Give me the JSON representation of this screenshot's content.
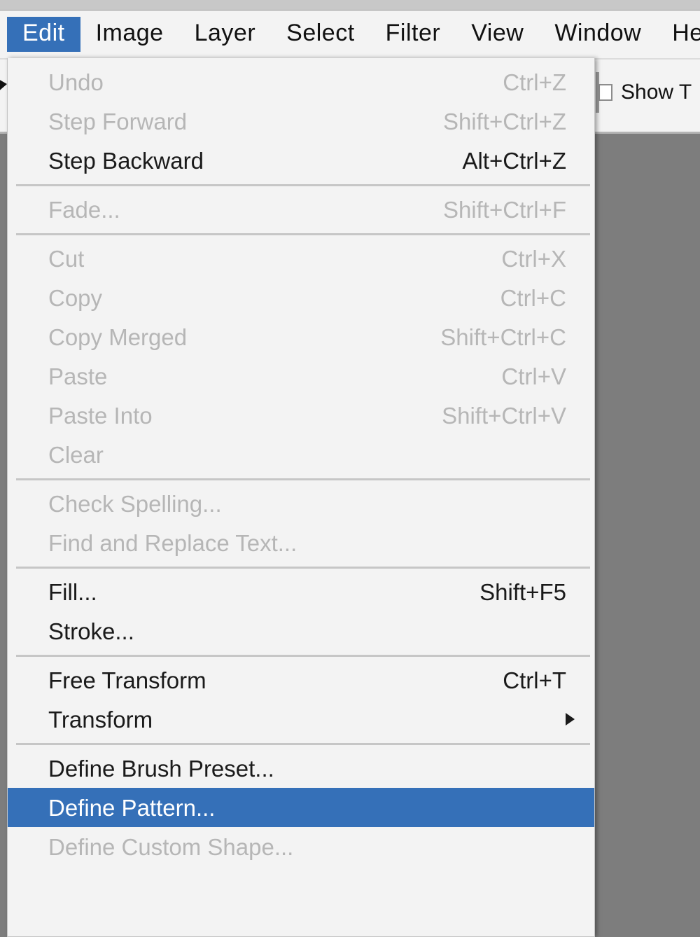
{
  "app": {
    "background_color": "#808080",
    "canvas_color": "#7d7d7d",
    "accent_color": "#3570b8",
    "panel_color": "#f3f3f3",
    "disabled_text_color": "#b6b6b6"
  },
  "menubar": {
    "items": [
      {
        "label": "Edit",
        "active": true
      },
      {
        "label": "Image",
        "active": false
      },
      {
        "label": "Layer",
        "active": false
      },
      {
        "label": "Select",
        "active": false
      },
      {
        "label": "Filter",
        "active": false
      },
      {
        "label": "View",
        "active": false
      },
      {
        "label": "Window",
        "active": false
      },
      {
        "label": "Help",
        "active": false
      }
    ]
  },
  "options_bar": {
    "checkbox_checked": false,
    "show_label": "Show T"
  },
  "dropdown": {
    "title": "Edit",
    "rows": [
      {
        "type": "item",
        "label": "Undo",
        "shortcut": "Ctrl+Z",
        "state": "disabled"
      },
      {
        "type": "item",
        "label": "Step Forward",
        "shortcut": "Shift+Ctrl+Z",
        "state": "disabled"
      },
      {
        "type": "item",
        "label": "Step Backward",
        "shortcut": "Alt+Ctrl+Z",
        "state": "enabled"
      },
      {
        "type": "separator"
      },
      {
        "type": "item",
        "label": "Fade...",
        "shortcut": "Shift+Ctrl+F",
        "state": "disabled"
      },
      {
        "type": "separator"
      },
      {
        "type": "item",
        "label": "Cut",
        "shortcut": "Ctrl+X",
        "state": "disabled"
      },
      {
        "type": "item",
        "label": "Copy",
        "shortcut": "Ctrl+C",
        "state": "disabled"
      },
      {
        "type": "item",
        "label": "Copy Merged",
        "shortcut": "Shift+Ctrl+C",
        "state": "disabled"
      },
      {
        "type": "item",
        "label": "Paste",
        "shortcut": "Ctrl+V",
        "state": "disabled"
      },
      {
        "type": "item",
        "label": "Paste Into",
        "shortcut": "Shift+Ctrl+V",
        "state": "disabled"
      },
      {
        "type": "item",
        "label": "Clear",
        "shortcut": "",
        "state": "disabled"
      },
      {
        "type": "separator"
      },
      {
        "type": "item",
        "label": "Check Spelling...",
        "shortcut": "",
        "state": "disabled"
      },
      {
        "type": "item",
        "label": "Find and Replace Text...",
        "shortcut": "",
        "state": "disabled"
      },
      {
        "type": "separator"
      },
      {
        "type": "item",
        "label": "Fill...",
        "shortcut": "Shift+F5",
        "state": "enabled"
      },
      {
        "type": "item",
        "label": "Stroke...",
        "shortcut": "",
        "state": "enabled"
      },
      {
        "type": "separator"
      },
      {
        "type": "item",
        "label": "Free Transform",
        "shortcut": "Ctrl+T",
        "state": "enabled"
      },
      {
        "type": "item",
        "label": "Transform",
        "shortcut": "",
        "state": "enabled",
        "submenu": true
      },
      {
        "type": "separator"
      },
      {
        "type": "item",
        "label": "Define Brush Preset...",
        "shortcut": "",
        "state": "enabled"
      },
      {
        "type": "item",
        "label": "Define Pattern...",
        "shortcut": "",
        "state": "highlighted"
      },
      {
        "type": "item",
        "label": "Define Custom Shape...",
        "shortcut": "",
        "state": "disabled"
      }
    ]
  }
}
